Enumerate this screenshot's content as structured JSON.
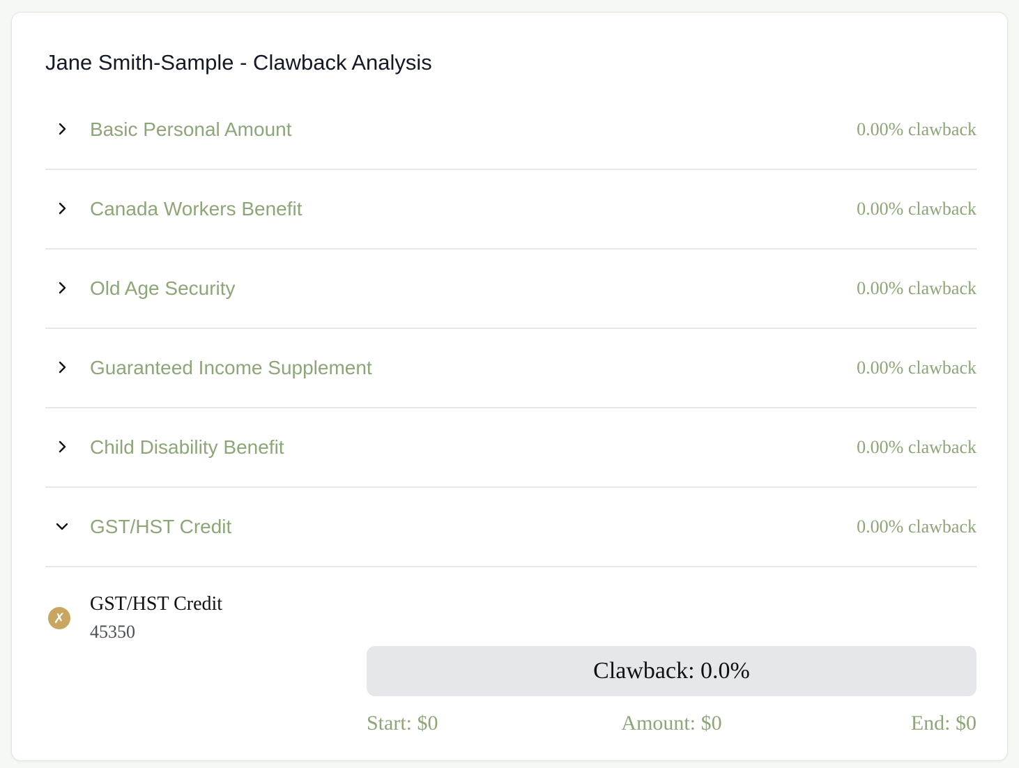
{
  "page": {
    "title": "Jane Smith-Sample - Clawback Analysis"
  },
  "benefits": [
    {
      "label": "Basic Personal Amount",
      "value": "0.00% clawback",
      "expanded": false
    },
    {
      "label": "Canada Workers Benefit",
      "value": "0.00% clawback",
      "expanded": false
    },
    {
      "label": "Old Age Security",
      "value": "0.00% clawback",
      "expanded": false
    },
    {
      "label": "Guaranteed Income Supplement",
      "value": "0.00% clawback",
      "expanded": false
    },
    {
      "label": "Child Disability Benefit",
      "value": "0.00% clawback",
      "expanded": false
    },
    {
      "label": "GST/HST Credit",
      "value": "0.00% clawback",
      "expanded": true
    }
  ],
  "detail": {
    "status_icon": "x-circle-icon",
    "status_glyph": "✗",
    "name": "GST/HST Credit",
    "code": "45350",
    "clawback_label": "Clawback: 0.0%",
    "clawback_fraction": 0,
    "start": "Start: $0",
    "amount": "Amount: $0",
    "end": "End: $0"
  },
  "colors": {
    "accent": "#8da678",
    "status_icon_bg": "#c8a662",
    "divider": "#e6e7ea",
    "title": "#131a26"
  }
}
